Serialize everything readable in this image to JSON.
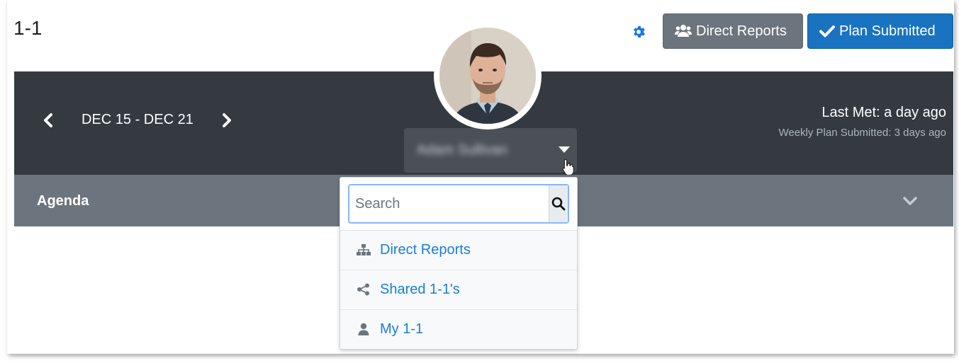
{
  "header": {
    "title": "1-1",
    "direct_reports_label": "Direct Reports",
    "plan_submitted_label": "Plan Submitted"
  },
  "week_nav": {
    "date_range": "DEC 15 - DEC 21"
  },
  "meeting_status": {
    "last_met": "Last Met: a day ago",
    "weekly_plan": "Weekly Plan Submitted: 3 days ago"
  },
  "user_selector": {
    "selected_name": "Adam Sullivan"
  },
  "agenda": {
    "label": "Agenda"
  },
  "dropdown": {
    "search_placeholder": "Search",
    "items": [
      {
        "label": "Direct Reports",
        "icon": "sitemap-icon"
      },
      {
        "label": "Shared 1-1's",
        "icon": "share-icon"
      },
      {
        "label": "My 1-1",
        "icon": "user-icon"
      }
    ]
  },
  "colors": {
    "dark_band": "#343a40",
    "agenda_band": "#6c757d",
    "primary": "#1a73c0",
    "link": "#1a7ed4"
  }
}
